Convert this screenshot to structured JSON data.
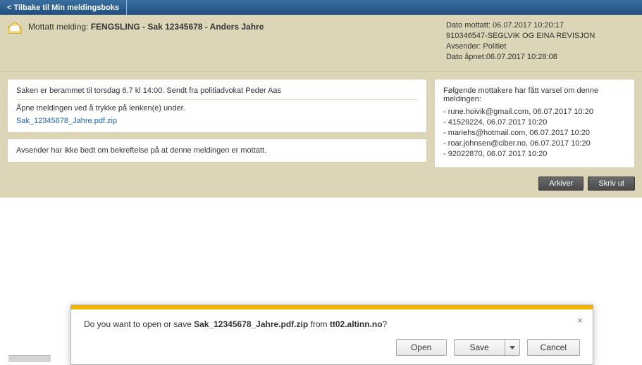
{
  "nav": {
    "back_label": "< Tilbake til Min meldingsboks"
  },
  "header": {
    "subject_label": "Mottatt melding: ",
    "subject_value": "FENGSLING - Sak 12345678 - Anders Jahre",
    "meta": {
      "received": "Dato mottatt: 06.07.2017 10:20:17",
      "org": "910346547-SEGLVIK OG EINA REVISJON",
      "sender": "Avsender: Politiet",
      "opened": "Dato åpnet:06.07.2017 10:28:08"
    }
  },
  "main": {
    "body_line": "Saken er berammet til torsdag 6.7 kl 14:00. Sendt fra politiadvokat Peder Aas",
    "open_instruction": "Åpne meldingen ved å trykke på lenken(e) under.",
    "attachment_link": "Sak_12345678_Jahre.pdf.zip",
    "confirm_text": "Avsender har ikke bedt om bekreftelse på at denne meldingen er mottatt."
  },
  "recipients": {
    "heading": "Følgende mottakere har fått varsel om denne meldingen:",
    "items": [
      "- rune.hoivik@gmail.com, 06.07.2017 10:20",
      "- 41529224, 06.07.2017 10:20",
      "- mariehs@hotmail.com, 06.07.2017 10:20",
      "- roar.johnsen@ciber.no, 06.07.2017 10:20",
      "- 92022870, 06.07.2017 10:20"
    ]
  },
  "actions": {
    "archive": "Arkiver",
    "print": "Skriv ut"
  },
  "download": {
    "prompt_prefix": "Do you want to open or save ",
    "filename": "Sak_12345678_Jahre.pdf.zip",
    "prompt_middle": " from ",
    "host": "tt02.altinn.no",
    "prompt_suffix": "?",
    "open": "Open",
    "save": "Save",
    "cancel": "Cancel"
  }
}
